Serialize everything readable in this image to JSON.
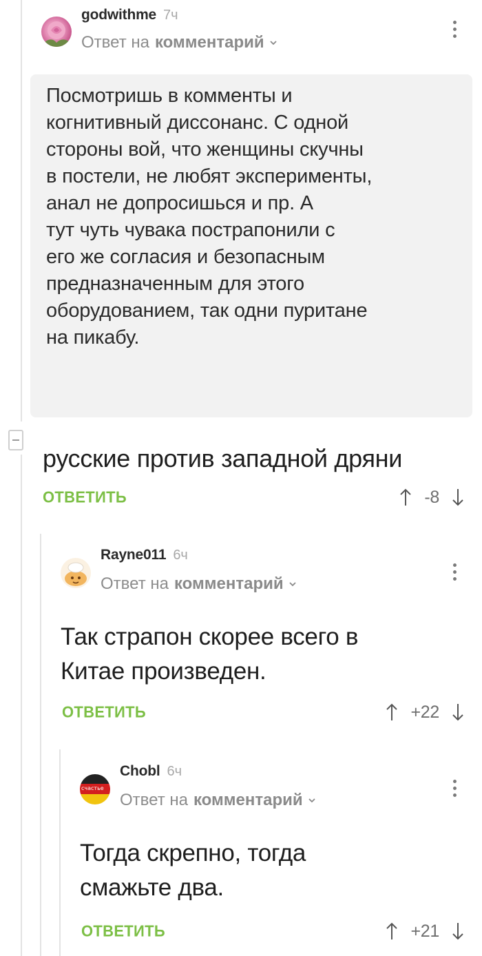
{
  "quoted_comment": {
    "author": "godwithme",
    "time": "7ч",
    "reply_prefix": "Ответ на",
    "reply_target": "комментарий",
    "text": "Посмотришь в комменты и\nкогнитивный диссонанс. С одной\nстороны вой, что женщины скучны\nв постели, не любят эксперименты,\nанал не допросишься и пр. А\nтут чуть чувака пострапонили с\nего же согласия и безопасным\nпредназначенным для этого\nоборудованием, так одни пуритане\nна пикабу."
  },
  "main_comment": {
    "text": "русские против западной дряни",
    "reply_label": "ОТВЕТИТЬ",
    "score": "-8"
  },
  "reply1": {
    "author": "Rayne011",
    "time": "6ч",
    "reply_prefix": "Ответ на",
    "reply_target": "комментарий",
    "text": "Так страпон скорее всего в\nКитае произведен.",
    "reply_label": "ОТВЕТИТЬ",
    "score": "+22"
  },
  "reply2": {
    "author": "Chobl",
    "time": "6ч",
    "reply_prefix": "Ответ на",
    "reply_target": "комментарий",
    "avatar_text": "счастье",
    "text": "Тогда скрепно, тогда\nсмажьте два.",
    "reply_label": "ОТВЕТИТЬ",
    "score": "+21"
  },
  "colors": {
    "accent_green": "#7cbf45",
    "quote_bg": "#f2f2f2",
    "muted": "#9a9a9a"
  }
}
